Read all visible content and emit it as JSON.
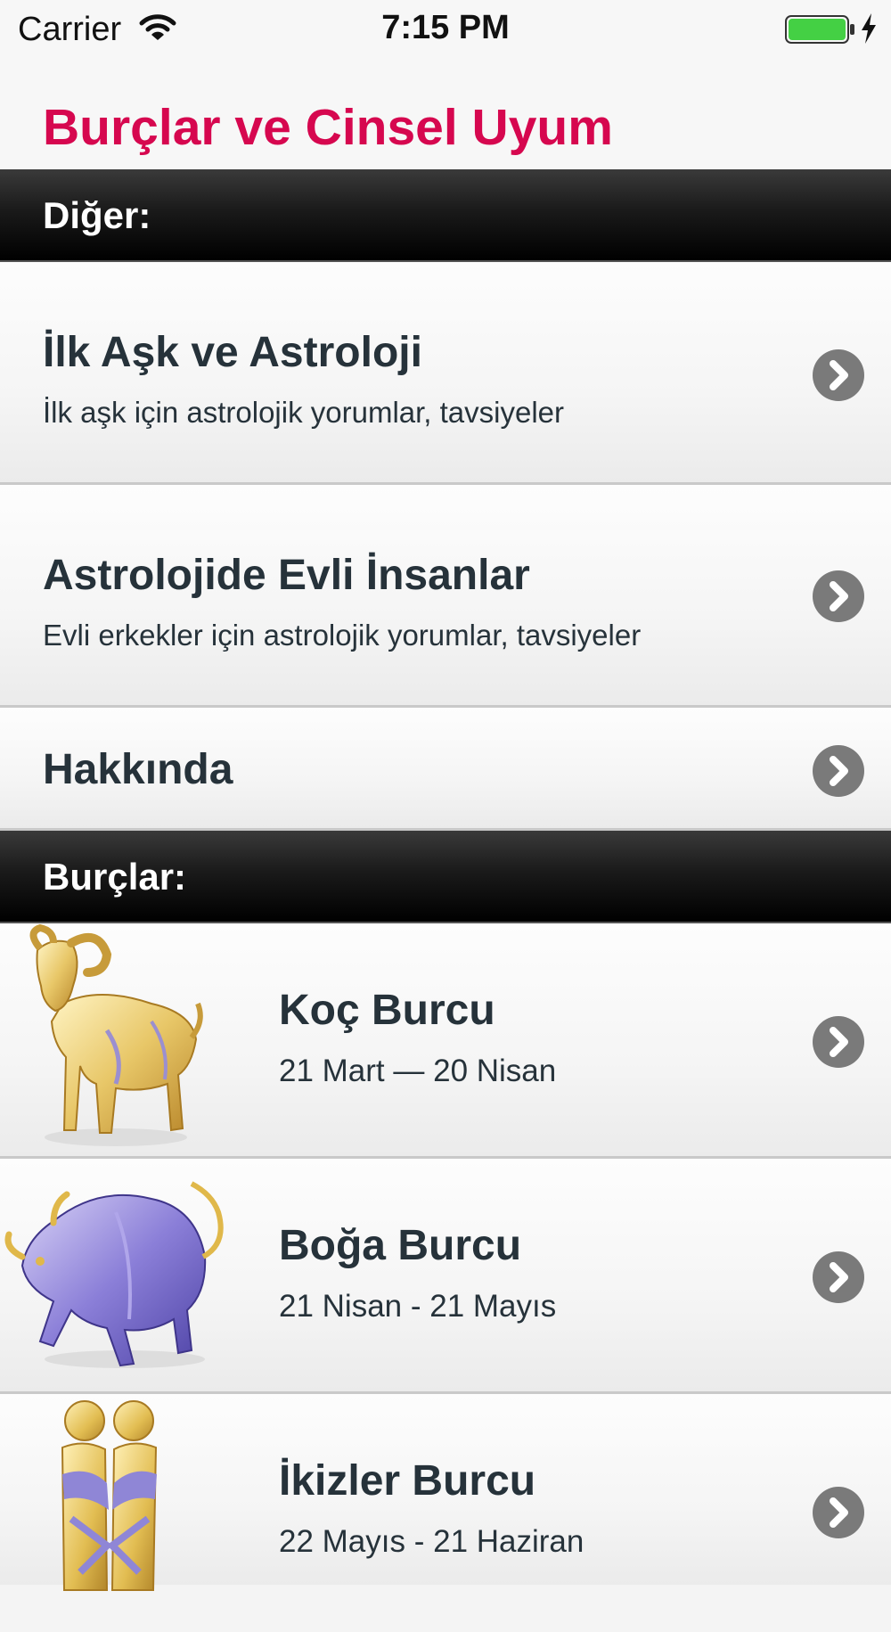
{
  "status_bar": {
    "carrier": "Carrier",
    "time": "7:15 PM",
    "battery_color": "#44d044"
  },
  "nav": {
    "title": "Burçlar ve Cinsel Uyum",
    "title_color": "#d6074f"
  },
  "sections": {
    "other_label": "Diğer:",
    "signs_label": "Burçlar:"
  },
  "other_items": [
    {
      "title": "İlk Aşk ve Astroloji",
      "subtitle": "İlk aşk için astrolojik yorumlar, tavsiyeler"
    },
    {
      "title": "Astrolojide Evli İnsanlar",
      "subtitle": "Evli erkekler için astrolojik yorumlar, tavsiyeler"
    },
    {
      "title": "Hakkında"
    }
  ],
  "signs": [
    {
      "title": "Koç Burcu",
      "dates": "21 Mart — 20 Nisan",
      "icon": "aries-ram-icon"
    },
    {
      "title": "Boğa Burcu",
      "dates": "21 Nisan - 21 Mayıs",
      "icon": "taurus-bull-icon"
    },
    {
      "title": "İkizler Burcu",
      "dates": "22 Mayıs - 21 Haziran",
      "icon": "gemini-twins-icon"
    }
  ]
}
